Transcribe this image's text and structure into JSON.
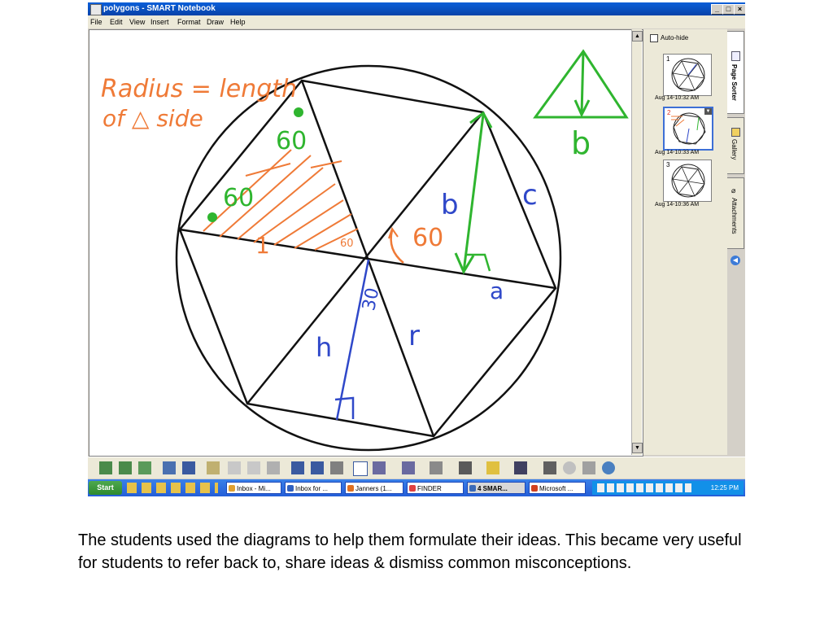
{
  "window": {
    "title": "polygons - SMART Notebook",
    "buttons": [
      "_",
      "□",
      "×"
    ]
  },
  "menu": [
    "File",
    "Edit",
    "View",
    "Insert",
    "Format",
    "Draw",
    "Help"
  ],
  "canvas": {
    "annotations": {
      "radius_note_line1": "Radius = length",
      "radius_note_line2": "of △ side",
      "angle_60_a": "60",
      "angle_60_b": "60",
      "angle_60_c": "60",
      "angle_60_small": "60",
      "angle_30": "30",
      "label_b_center": "b",
      "label_b_triangle": "b",
      "label_c": "c",
      "label_a": "a",
      "label_h": "h",
      "label_r": "r",
      "tick_1": "1"
    },
    "colors": {
      "orange": "#ef7a37",
      "green": "#2fb52f",
      "blue": "#2f48c9",
      "black": "#111111"
    }
  },
  "side_panel": {
    "autohide_label": "Auto-hide",
    "pages": [
      {
        "number": "1",
        "date": "Aug 14-10:32 AM"
      },
      {
        "number": "2",
        "date": "Aug 14-10:33 AM"
      },
      {
        "number": "3",
        "date": "Aug 14-10:36 AM"
      }
    ],
    "tabs": [
      "Page Sorter",
      "Gallery",
      "Attachments"
    ]
  },
  "taskbar": {
    "start_label": "Start",
    "tasks": [
      "Inbox - Mi...",
      "Inbox for ...",
      "Janners (1...",
      "FINDER",
      "4 SMAR...",
      "Microsoft ..."
    ],
    "clock": "12:25 PM"
  },
  "caption": "The students used the diagrams to help them formulate their ideas.  This became very useful for students to refer back to, share ideas & dismiss common misconceptions."
}
